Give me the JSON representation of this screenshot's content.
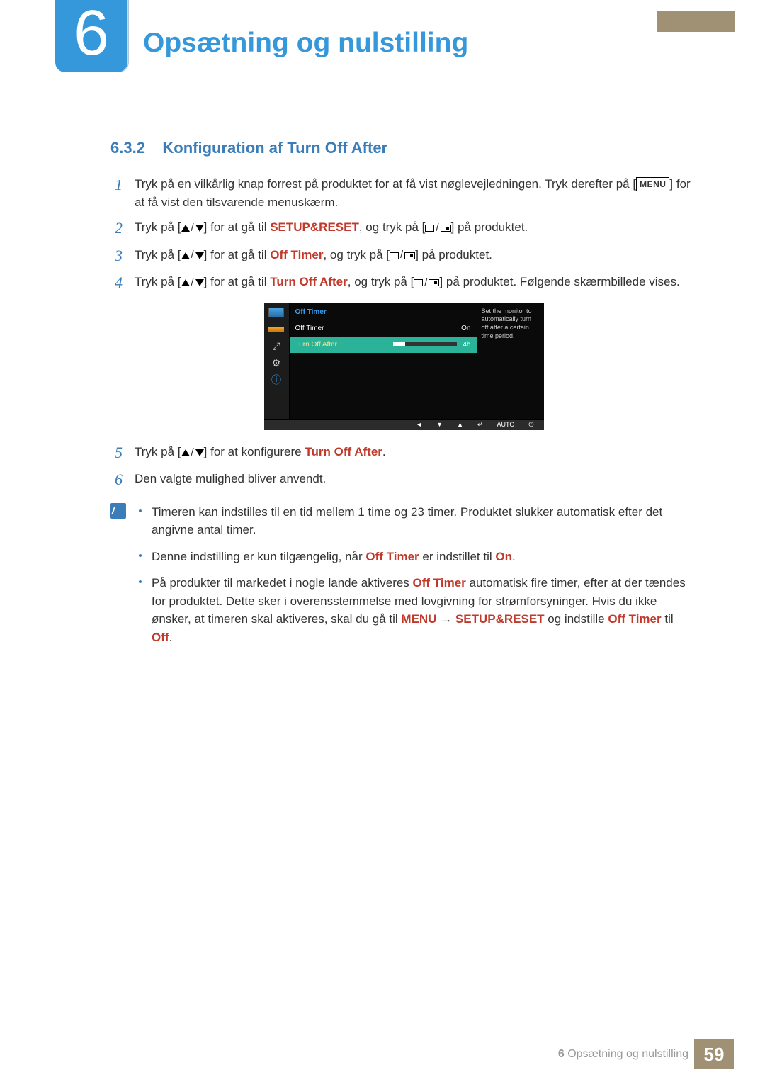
{
  "chapter": {
    "number": "6",
    "title": "Opsætning og nulstilling"
  },
  "section": {
    "number": "6.3.2",
    "title": "Konfiguration af Turn Off After"
  },
  "steps": {
    "s1a": "Tryk på en vilkårlig knap forrest på produktet for at få vist nøglevejledningen. Tryk derefter på [",
    "s1menu": "MENU",
    "s1b": "] for at få vist den tilsvarende menuskærm.",
    "s2a": "Tryk på [",
    "s2b": "] for at gå til ",
    "s2target": "SETUP&RESET",
    "s2c": ", og tryk på [",
    "s2d": "] på produktet.",
    "s3a": "Tryk på [",
    "s3b": "] for at gå til ",
    "s3target": "Off Timer",
    "s3c": ", og tryk på [",
    "s3d": "] på produktet.",
    "s4a": "Tryk på [",
    "s4b": "] for at gå til ",
    "s4target": "Turn Off After",
    "s4c": ", og tryk på [",
    "s4d": "] på produktet. Følgende skærmbillede vises.",
    "s5a": "Tryk på [",
    "s5b": "] for at konfigurere ",
    "s5target": "Turn Off After",
    "s5c": ".",
    "s6": "Den valgte mulighed bliver anvendt."
  },
  "osd": {
    "title": "Off Timer",
    "row_offtimer": "Off Timer",
    "row_offtimer_val": "On",
    "row_turnoff": "Turn Off After",
    "row_turnoff_val": "4h",
    "help": "Set the monitor to automatically turn off after a certain time period.",
    "bottom_auto": "AUTO"
  },
  "notes": {
    "b1": "Timeren kan indstilles til en tid mellem 1 time og 23 timer. Produktet slukker automatisk efter det angivne antal timer.",
    "b2a": "Denne indstilling er kun tilgængelig, når ",
    "b2ot": "Off Timer",
    "b2b": " er indstillet til ",
    "b2on": "On",
    "b2c": ".",
    "b3a": "På produkter til markedet i nogle lande aktiveres ",
    "b3ot": "Off Timer",
    "b3b": " automatisk fire timer, efter at der tændes for produktet. Dette sker i overensstemmelse med lovgivning for strømforsyninger. Hvis du ikke ønsker, at timeren skal aktiveres, skal du gå til ",
    "b3menu": "MENU",
    "b3arrow": " → ",
    "b3sr": "SETUP&RESET",
    "b3c": " og indstille ",
    "b3ot2": "Off Timer",
    "b3d": " til ",
    "b3off": "Off",
    "b3e": "."
  },
  "footer": {
    "chapnum": "6",
    "chaptitle": "Opsætning og nulstilling",
    "page": "59"
  }
}
